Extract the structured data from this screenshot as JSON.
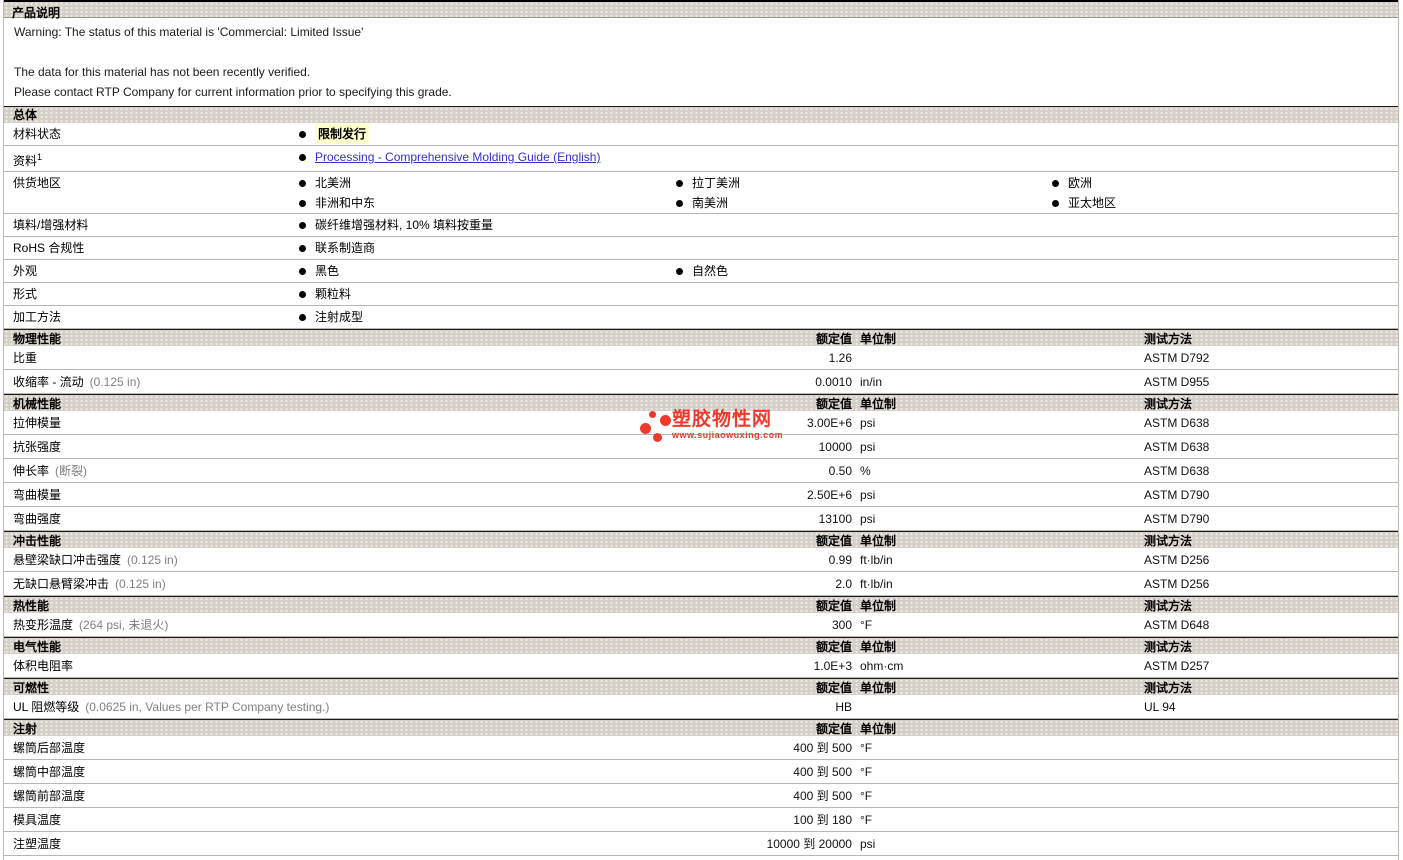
{
  "colors": {
    "header_bg": "#d4d0c8",
    "highlight_yellow": "#ffffcc",
    "link_blue": "#3330cc",
    "accent_red": "#ee3a2c"
  },
  "header": {
    "title": "产品说明"
  },
  "warning": {
    "line1": "Warning: The status of this material is 'Commercial: Limited Issue'",
    "line2": "The data for this material has not been recently verified.",
    "line3": "Please contact RTP Company for current information prior to specifying this grade."
  },
  "columns": {
    "value": "额定值",
    "unit": "单位制",
    "method": "测试方法"
  },
  "general": {
    "title": "总体",
    "rows": [
      {
        "label": "材料状态",
        "style": "highlight",
        "columns": [
          [
            "限制发行"
          ]
        ]
      },
      {
        "label": "资料",
        "sup": "1",
        "style": "link",
        "columns": [
          [
            "Processing - Comprehensive Molding Guide (English)"
          ]
        ]
      },
      {
        "label": "供货地区",
        "style": "plain",
        "columns": [
          [
            "北美洲",
            "非洲和中东"
          ],
          [
            "拉丁美洲",
            "南美洲"
          ],
          [
            "欧洲",
            "亚太地区"
          ]
        ]
      },
      {
        "label": "填料/增强材料",
        "style": "plain",
        "columns": [
          [
            "碳纤维增强材料, 10% 填料按重量"
          ]
        ]
      },
      {
        "label": "RoHS 合规性",
        "style": "plain",
        "columns": [
          [
            "联系制造商"
          ]
        ]
      },
      {
        "label": "外观",
        "style": "plain",
        "columns": [
          [
            "黑色"
          ],
          [
            "自然色"
          ]
        ]
      },
      {
        "label": "形式",
        "style": "plain",
        "columns": [
          [
            "颗粒料"
          ]
        ]
      },
      {
        "label": "加工方法",
        "style": "plain",
        "columns": [
          [
            "注射成型"
          ]
        ]
      }
    ]
  },
  "property_sections": [
    {
      "title": "物理性能",
      "show_method": true,
      "rows": [
        {
          "name": "比重",
          "note": "",
          "value": "1.26",
          "unit": "",
          "method": "ASTM D792"
        },
        {
          "name": "收缩率 - 流动",
          "note": "(0.125 in)",
          "value": "0.0010",
          "unit": "in/in",
          "method": "ASTM D955"
        }
      ]
    },
    {
      "title": "机械性能",
      "show_method": true,
      "rows": [
        {
          "name": "拉伸模量",
          "note": "",
          "value": "3.00E+6",
          "unit": "psi",
          "method": "ASTM D638"
        },
        {
          "name": "抗张强度",
          "note": "",
          "value": "10000",
          "unit": "psi",
          "method": "ASTM D638"
        },
        {
          "name": "伸长率",
          "note": "(断裂)",
          "value": "0.50",
          "unit": "%",
          "method": "ASTM D638"
        },
        {
          "name": "弯曲模量",
          "note": "",
          "value": "2.50E+6",
          "unit": "psi",
          "method": "ASTM D790"
        },
        {
          "name": "弯曲强度",
          "note": "",
          "value": "13100",
          "unit": "psi",
          "method": "ASTM D790"
        }
      ]
    },
    {
      "title": "冲击性能",
      "show_method": true,
      "rows": [
        {
          "name": "悬壁梁缺口冲击强度",
          "note": "(0.125 in)",
          "value": "0.99",
          "unit": "ft·lb/in",
          "method": "ASTM D256"
        },
        {
          "name": "无缺口悬臂梁冲击",
          "note": "(0.125 in)",
          "value": "2.0",
          "unit": "ft·lb/in",
          "method": "ASTM D256"
        }
      ]
    },
    {
      "title": "热性能",
      "show_method": true,
      "rows": [
        {
          "name": "热变形温度",
          "note": "(264 psi, 未退火)",
          "value": "300",
          "unit": "°F",
          "method": "ASTM D648"
        }
      ]
    },
    {
      "title": "电气性能",
      "show_method": true,
      "rows": [
        {
          "name": "体积电阻率",
          "note": "",
          "value": "1.0E+3",
          "unit": "ohm·cm",
          "method": "ASTM D257"
        }
      ]
    },
    {
      "title": "可燃性",
      "show_method": true,
      "rows": [
        {
          "name": "UL 阻燃等级",
          "note": "(0.0625 in, Values per RTP Company testing.)",
          "value": "HB",
          "unit": "",
          "method": "UL 94"
        }
      ]
    },
    {
      "title": "注射",
      "show_method": false,
      "rows": [
        {
          "name": "螺筒后部温度",
          "note": "",
          "value": "400 到 500",
          "unit": "°F",
          "method": ""
        },
        {
          "name": "螺筒中部温度",
          "note": "",
          "value": "400 到 500",
          "unit": "°F",
          "method": ""
        },
        {
          "name": "螺筒前部温度",
          "note": "",
          "value": "400 到 500",
          "unit": "°F",
          "method": ""
        },
        {
          "name": "模具温度",
          "note": "",
          "value": "100 到 180",
          "unit": "°F",
          "method": ""
        },
        {
          "name": "注塑温度",
          "note": "",
          "value": "10000 到 20000",
          "unit": "psi",
          "method": ""
        }
      ]
    }
  ],
  "watermark": {
    "site_name": "塑胶物性网",
    "site_url": "www.sujiaowuxing.com"
  }
}
